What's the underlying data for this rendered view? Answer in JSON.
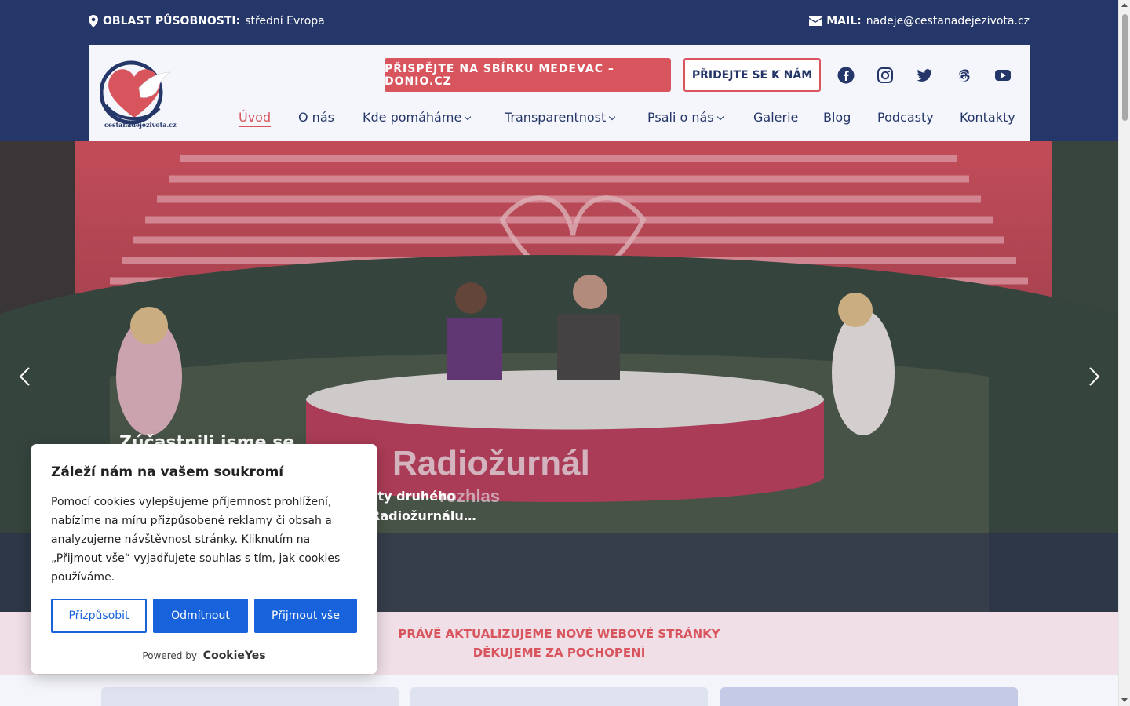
{
  "topbar": {
    "area_label": "OBLAST PŮSOBNOSTI:",
    "area_value": "střední Evropa",
    "mail_label": "MAIL:",
    "mail_value": "nadeje@cestanadejezivota.cz"
  },
  "header": {
    "logo_text": "cestanadejezivota.cz",
    "donate_button": "PŘISPĚJTE NA SBÍRKU MEDEVAC – DONIO.CZ",
    "join_button": "PŘIDEJTE SE K NÁM",
    "social": [
      "facebook-icon",
      "instagram-icon",
      "twitter-icon",
      "threads-icon",
      "youtube-icon"
    ]
  },
  "nav": {
    "items": [
      {
        "label": "Úvod",
        "active": true
      },
      {
        "label": "O nás"
      },
      {
        "label": "Kde pomáháme",
        "dropdown": true
      },
      {
        "label": "Transparentnost",
        "dropdown": true
      },
      {
        "label": "Psali o nás",
        "dropdown": true
      },
      {
        "label": "Galerie"
      },
      {
        "label": "Blog"
      },
      {
        "label": "Podcasty"
      },
      {
        "label": "Kontakty"
      }
    ]
  },
  "hero": {
    "title": "Zúčastnili jsme se",
    "text_partial": "sty druhého Radiožurnálu…",
    "banner_text": "Radiožurnál",
    "banner_sub": "rozhlas"
  },
  "notice": {
    "line1": "PRÁVĚ AKTUALIZUJEME NOVÉ WEBOVÉ STRÁNKY",
    "line2": "DĚKUJEME ZA POCHOPENÍ"
  },
  "cookie": {
    "title": "Záleží nám na vašem soukromí",
    "body": "Pomocí cookies vylepšujeme příjemnost prohlížení, nabízíme na míru přizpůsobené reklamy či obsah a analyzujeme návštěvnost stránky. Kliknutím na „Přijmout vše“ vyjadřujete souhlas s tím, jak cookies používáme.",
    "btn_customize": "Přizpůsobit",
    "btn_reject": "Odmítnout",
    "btn_accept": "Přijmout vše",
    "powered_by": "Powered by",
    "brand": "CookieYes"
  },
  "colors": {
    "navy": "#253668",
    "accent": "#d8555e",
    "cookie_blue": "#1863dc"
  }
}
